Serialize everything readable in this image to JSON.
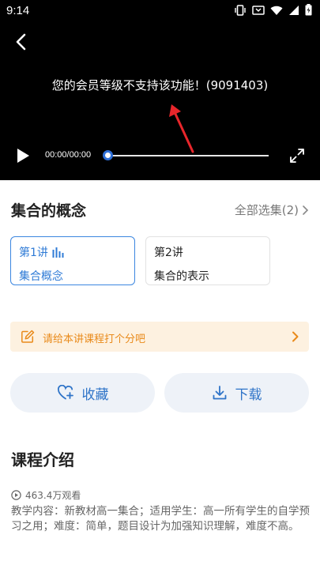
{
  "status_bar": {
    "time": "9:14",
    "icons": [
      "vibrate-icon",
      "cast-icon",
      "wifi-icon",
      "signal-icon",
      "battery-icon"
    ]
  },
  "player": {
    "message": "您的会员等级不支持该功能！(9091403)",
    "time_display": "00:00/00:00",
    "progress": 0,
    "accent_color": "#2e6fd8",
    "annotation_color": "#e8262b"
  },
  "course": {
    "title": "集合的概念",
    "all_episodes": "全部选集(2)",
    "lectures": [
      {
        "number": "第1讲",
        "name": "集合概念",
        "active": true
      },
      {
        "number": "第2讲",
        "name": "集合的表示",
        "active": false
      }
    ]
  },
  "rating": {
    "prompt": "请给本讲课程打个分吧",
    "color": "#e98a1a"
  },
  "actions": {
    "favorite_label": "收藏",
    "download_label": "下载"
  },
  "intro": {
    "title": "课程介绍",
    "views": "463.4万观看",
    "description": "教学内容：新教材高一集合；适用学生：高一所有学生的自学预习之用；难度：简单，题目设计为加强知识理解，难度不高。"
  }
}
